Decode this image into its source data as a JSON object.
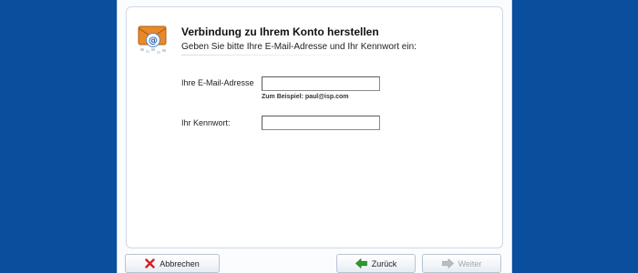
{
  "dialog": {
    "title": "Verbindung zu Ihrem Konto herstellen",
    "subtitle": "Geben Sie bitte Ihre E-Mail-Adresse und Ihr Kennwort ein:"
  },
  "form": {
    "email_label": "Ihre E-Mail-Adresse",
    "email_value": "",
    "email_hint": "Zum Beispiel: paul@isp.com",
    "password_label": "Ihr Kennwort:",
    "password_value": ""
  },
  "buttons": {
    "cancel": "Abbrechen",
    "back": "Zurück",
    "next": "Weiter"
  },
  "icons": {
    "mail": "mail-at-envelope-icon",
    "cancel": "red-x-icon",
    "back": "green-arrow-left-icon",
    "next": "gray-arrow-right-icon"
  },
  "colors": {
    "background": "#0a4e9e",
    "cancel_icon": "#d32020",
    "back_icon": "#2e9a2e",
    "next_icon_disabled": "#b8bec6"
  }
}
